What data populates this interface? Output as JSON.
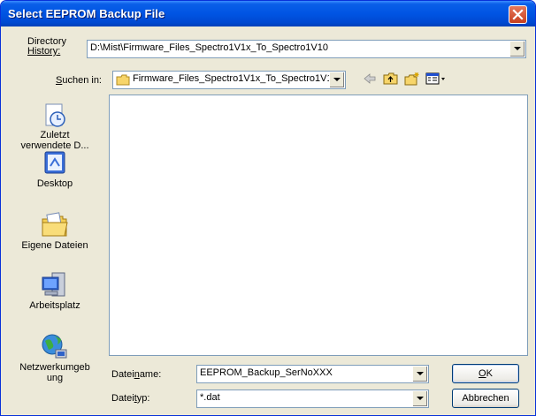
{
  "window": {
    "title": "Select EEPROM Backup File"
  },
  "history": {
    "label_line1": "Directory",
    "label_line2": "History:",
    "value": "D:\\Mist\\Firmware_Files_Spectro1V1x_To_Spectro1V10"
  },
  "lookin": {
    "label_accel": "S",
    "label_rest": "uchen in:",
    "value": "Firmware_Files_Spectro1V1x_To_Spectro1V1"
  },
  "toolbar": {
    "back_icon": "back-arrow-icon",
    "up_icon": "up-folder-icon",
    "new_icon": "new-folder-icon",
    "view_icon": "view-menu-icon"
  },
  "places": [
    {
      "line1": "Zuletzt",
      "line2": "verwendete D...",
      "icon": "recent-documents-icon"
    },
    {
      "line1": "Desktop",
      "line2": "",
      "icon": "desktop-icon"
    },
    {
      "line1": "Eigene Dateien",
      "line2": "",
      "icon": "my-documents-icon"
    },
    {
      "line1": "Arbeitsplatz",
      "line2": "",
      "icon": "my-computer-icon"
    },
    {
      "line1": "Netzwerkumgeb",
      "line2": "ung",
      "icon": "network-places-icon"
    }
  ],
  "filename": {
    "label_pre": "Datei",
    "label_accel": "n",
    "label_post": "ame:",
    "value": "EEPROM_Backup_SerNoXXX"
  },
  "filetype": {
    "label_pre": "Datei",
    "label_accel": "t",
    "label_post": "yp:",
    "value": "*.dat"
  },
  "buttons": {
    "ok_accel": "O",
    "ok_rest": "K",
    "cancel": "Abbrechen"
  },
  "colors": {
    "titlebar": "#0054e3",
    "dialog_bg": "#ece9d8",
    "field_border": "#7f9db9"
  }
}
